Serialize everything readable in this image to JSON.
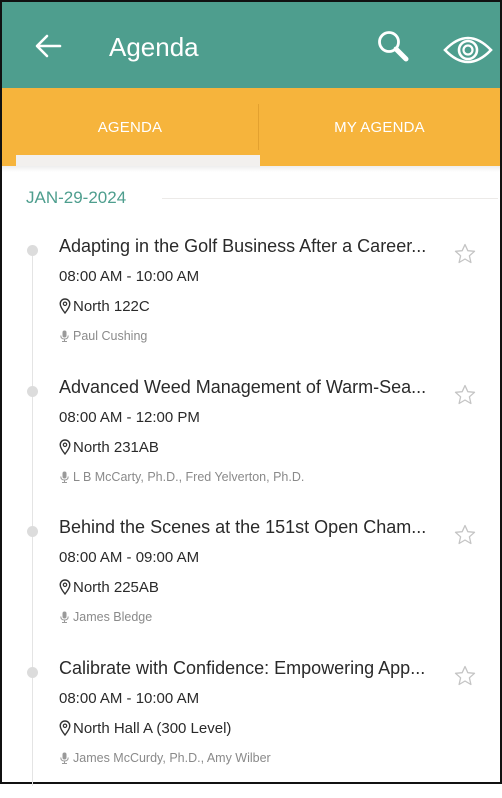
{
  "header": {
    "title": "Agenda",
    "back_icon": "arrow-left-icon",
    "search_icon": "search-icon",
    "eye_icon": "eye-icon",
    "bg_color": "#4e9e8e"
  },
  "tabs": {
    "items": [
      {
        "label": "AGENDA",
        "selected": true
      },
      {
        "label": "MY AGENDA",
        "selected": false
      }
    ],
    "bg_color": "#f6b43c"
  },
  "date": "JAN-29-2024",
  "sessions": [
    {
      "title": "Adapting in the Golf Business After a Career...",
      "time": "08:00 AM - 10:00 AM",
      "location": "North 122C",
      "speakers": "Paul Cushing"
    },
    {
      "title": "Advanced Weed Management of Warm-Sea...",
      "time": "08:00 AM - 12:00 PM",
      "location": "North 231AB",
      "speakers": "L B McCarty, Ph.D., Fred Yelverton, Ph.D."
    },
    {
      "title": "Behind the Scenes at the 151st Open Cham...",
      "time": "08:00 AM - 09:00 AM",
      "location": "North 225AB",
      "speakers": "James Bledge"
    },
    {
      "title": "Calibrate with Confidence: Empowering App...",
      "time": "08:00 AM - 10:00 AM",
      "location": "North Hall A (300 Level)",
      "speakers": "James McCurdy, Ph.D., Amy Wilber"
    }
  ]
}
